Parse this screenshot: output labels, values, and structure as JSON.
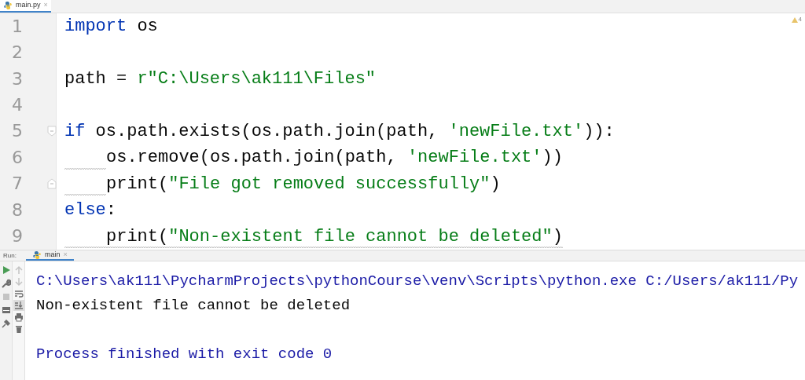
{
  "editor_tab": {
    "label": "main.py",
    "close": "×",
    "selected": true
  },
  "inspection": {
    "warnings": "4"
  },
  "code_lines": [
    {
      "number": "1",
      "tokens": [
        {
          "kind": "keyword",
          "text": "import"
        },
        {
          "kind": "plain",
          "text": " os"
        }
      ]
    },
    {
      "number": "2"
    },
    {
      "number": "3",
      "tokens": [
        {
          "kind": "plain",
          "text": "path = "
        },
        {
          "kind": "string",
          "text": "r\"C:\\Users\\ak111\\Files\""
        }
      ]
    },
    {
      "number": "4"
    },
    {
      "number": "5",
      "fold_start": true,
      "fold_end": false,
      "tokens": [
        {
          "kind": "keyword",
          "text": "if"
        },
        {
          "kind": "plain",
          "text": " os.path.exists(os.path.join(path, "
        },
        {
          "kind": "string",
          "text": "'newFile.txt'"
        },
        {
          "kind": "plain",
          "text": ")):"
        }
      ]
    },
    {
      "number": "6",
      "indented": true,
      "indent_warning": true,
      "tokens": [
        {
          "kind": "plain",
          "text": "os.remove(os.path.join(path, "
        },
        {
          "kind": "string",
          "text": "'newFile.txt'"
        },
        {
          "kind": "plain",
          "text": "))"
        }
      ]
    },
    {
      "number": "7",
      "fold_start": false,
      "fold_end": true,
      "indented": true,
      "indent_warning": true,
      "tokens": [
        {
          "kind": "plain",
          "text": "print("
        },
        {
          "kind": "string",
          "text": "\"File got removed successfully\""
        },
        {
          "kind": "plain",
          "text": ")"
        }
      ]
    },
    {
      "number": "8",
      "tokens": [
        {
          "kind": "keyword",
          "text": "else"
        },
        {
          "kind": "plain",
          "text": ":"
        }
      ]
    },
    {
      "number": "9",
      "indented": true,
      "line_warning": true,
      "tokens": [
        {
          "kind": "plain",
          "text": "print("
        },
        {
          "kind": "string",
          "text": "\"Non-existent file cannot be deleted\""
        },
        {
          "kind": "plain",
          "text": ")"
        }
      ]
    }
  ],
  "run_panel": {
    "label": "Run:",
    "tab": {
      "label": "main",
      "close": "×",
      "selected": true
    },
    "toolbar_left": [
      {
        "kind": "play",
        "disabled": false
      },
      {
        "kind": "wrench",
        "disabled": false
      },
      {
        "kind": "stop",
        "disabled": true
      },
      {
        "kind": "layout",
        "disabled": false
      },
      {
        "kind": "pin",
        "disabled": false
      }
    ],
    "toolbar_right": [
      {
        "kind": "up",
        "disabled": true,
        "selected": false
      },
      {
        "kind": "down",
        "disabled": true,
        "selected": false
      },
      {
        "kind": "wrap",
        "disabled": false,
        "selected": false
      },
      {
        "kind": "scroll",
        "disabled": false,
        "selected": true
      },
      {
        "kind": "print",
        "disabled": false,
        "selected": false
      },
      {
        "kind": "trash",
        "disabled": false,
        "selected": false
      }
    ],
    "output": [
      {
        "kind": "command",
        "text": "C:\\Users\\ak111\\PycharmProjects\\pythonCourse\\venv\\Scripts\\python.exe C:/Users/ak111/Py"
      },
      {
        "kind": "stdout",
        "text": "Non-existent file cannot be deleted"
      },
      {
        "kind": "system",
        "text": "Process finished with exit code 0"
      }
    ]
  }
}
